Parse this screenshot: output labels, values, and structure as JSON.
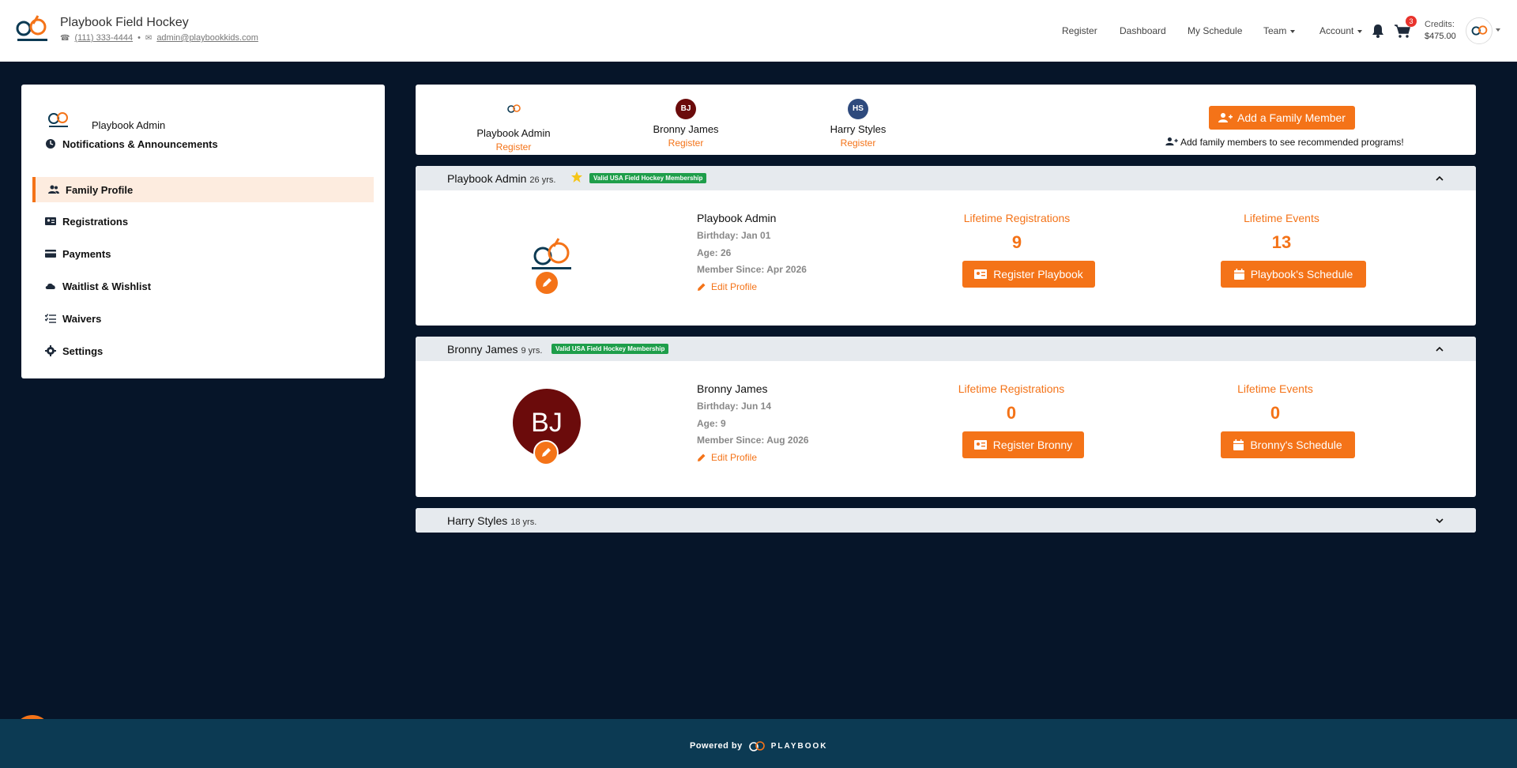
{
  "header": {
    "title": "Playbook Field Hockey",
    "phone": "(111) 333-4444",
    "email": "admin@playbookkids.com",
    "nav": [
      "Register",
      "Dashboard",
      "My Schedule",
      "Team",
      "Account"
    ],
    "cart_count": "3",
    "credits_label": "Credits:",
    "credits_amount": "$475.00"
  },
  "sidebar": {
    "user": "Playbook Admin",
    "items": [
      {
        "label": "Notifications & Announcements",
        "icon": "clock-icon"
      },
      {
        "label": "Family Profile",
        "icon": "users-icon"
      },
      {
        "label": "Registrations",
        "icon": "id-card-icon"
      },
      {
        "label": "Payments",
        "icon": "credit-card-icon"
      },
      {
        "label": "Waitlist & Wishlist",
        "icon": "cloud-icon"
      },
      {
        "label": "Waivers",
        "icon": "list-check-icon"
      },
      {
        "label": "Settings",
        "icon": "gear-icon"
      }
    ]
  },
  "family_tabs": [
    {
      "name": "Playbook Admin",
      "link": "Register",
      "initials": ""
    },
    {
      "name": "Bronny James",
      "link": "Register",
      "initials": "BJ"
    },
    {
      "name": "Harry Styles",
      "link": "Register",
      "initials": "HS"
    }
  ],
  "add_member": {
    "button": "Add a Family Member",
    "hint": "Add family members to see recommended programs!"
  },
  "members": [
    {
      "header_name": "Playbook Admin",
      "age_label": "26 yrs.",
      "badge": "Valid USA Field Hockey Membership",
      "name": "Playbook Admin",
      "birthday": "Birthday: Jan 01",
      "age": "Age: 26",
      "member_since": "Member Since: Apr 2026",
      "edit": "Edit Profile",
      "reg_label": "Lifetime Registrations",
      "reg_value": "9",
      "events_label": "Lifetime Events",
      "events_value": "13",
      "register_btn": "Register Playbook",
      "schedule_btn": "Playbook's Schedule"
    },
    {
      "header_name": "Bronny James",
      "age_label": "9 yrs.",
      "badge": "Valid USA Field Hockey Membership",
      "initials": "BJ",
      "name": "Bronny James",
      "birthday": "Birthday: Jun 14",
      "age": "Age: 9",
      "member_since": "Member Since: Aug 2026",
      "edit": "Edit Profile",
      "reg_label": "Lifetime Registrations",
      "reg_value": "0",
      "events_label": "Lifetime Events",
      "events_value": "0",
      "register_btn": "Register Bronny",
      "schedule_btn": "Bronny's Schedule"
    },
    {
      "header_name": "Harry Styles",
      "age_label": "18 yrs."
    }
  ],
  "footer": {
    "powered": "Powered by",
    "brand": "PLAYBOOK"
  },
  "colors": {
    "accent": "#f47318",
    "background": "#061529",
    "footer": "#0c3a53",
    "badge_green": "#1e9e4a",
    "bj_avatar": "#6b0b0b",
    "hs_avatar": "#2e4a7d"
  }
}
